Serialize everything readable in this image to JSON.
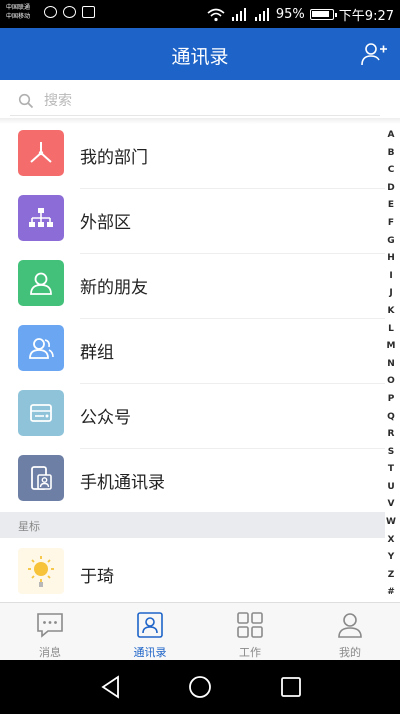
{
  "status_bar": {
    "carrier_1": "中国联通",
    "carrier_2": "中国移动",
    "battery": "95%",
    "time": "下午9:27"
  },
  "header": {
    "title": "通讯录"
  },
  "search": {
    "placeholder": "搜索"
  },
  "menu_items": [
    {
      "label": "我的部门",
      "icon": "department-icon",
      "color": "#f46c6c"
    },
    {
      "label": "外部区",
      "icon": "org-chart-icon",
      "color": "#8c6cd6"
    },
    {
      "label": "新的朋友",
      "icon": "new-friend-icon",
      "color": "#43c17a"
    },
    {
      "label": "群组",
      "icon": "group-icon",
      "color": "#6aa6f2"
    },
    {
      "label": "公众号",
      "icon": "official-account-icon",
      "color": "#8ec3d9"
    },
    {
      "label": "手机通讯录",
      "icon": "phone-contacts-icon",
      "color": "#6d7fa5"
    }
  ],
  "section": {
    "label": "星标"
  },
  "contacts": [
    {
      "name": "于琦",
      "avatar": "sun-avatar"
    }
  ],
  "alphabet": [
    "A",
    "B",
    "C",
    "D",
    "E",
    "F",
    "G",
    "H",
    "I",
    "J",
    "K",
    "L",
    "M",
    "N",
    "O",
    "P",
    "Q",
    "R",
    "S",
    "T",
    "U",
    "V",
    "W",
    "X",
    "Y",
    "Z",
    "#"
  ],
  "tabs": [
    {
      "label": "消息",
      "icon": "message-icon",
      "active": false
    },
    {
      "label": "通讯录",
      "icon": "contacts-icon",
      "active": true
    },
    {
      "label": "工作",
      "icon": "apps-grid-icon",
      "active": false
    },
    {
      "label": "我的",
      "icon": "profile-icon",
      "active": false
    }
  ],
  "colors": {
    "brand": "#1e64c8",
    "tab_active": "#1e64c8",
    "tab_inactive": "#8a8a8a"
  }
}
